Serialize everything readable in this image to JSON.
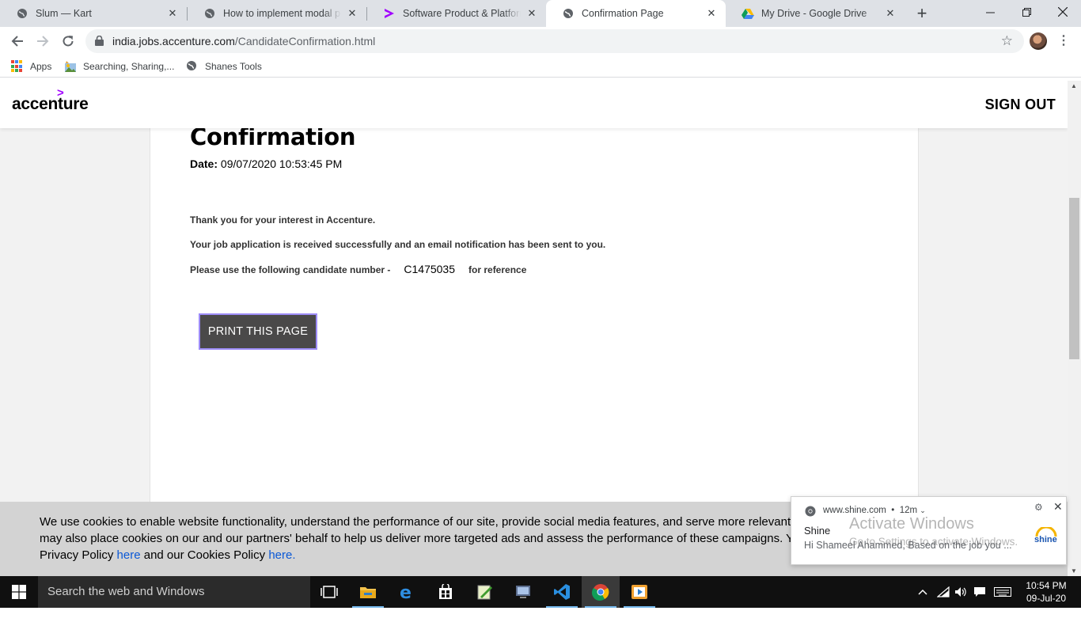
{
  "browser": {
    "tabs": [
      {
        "title": "Slum — Kart",
        "icon": "globe-icon",
        "active": false
      },
      {
        "title": "How to implement modal pop",
        "icon": "globe-icon",
        "active": false
      },
      {
        "title": "Software Product & Platforms",
        "icon": "accenture-icon",
        "active": false
      },
      {
        "title": "Confirmation Page",
        "icon": "globe-icon",
        "active": true
      },
      {
        "title": "My Drive - Google Drive",
        "icon": "drive-icon",
        "active": false
      }
    ],
    "new_tab": "+",
    "url_host": "india.jobs.accenture.com",
    "url_path": "/CandidateConfirmation.html",
    "bookmarks": [
      {
        "label": "Apps",
        "icon": "apps-grid-icon"
      },
      {
        "label": "Searching, Sharing,...",
        "icon": "bookmark-image-icon"
      },
      {
        "label": "Shanes Tools",
        "icon": "globe-icon"
      }
    ]
  },
  "site": {
    "logo": "accenture",
    "logo_accent": ">",
    "sign_out": "SIGN OUT",
    "accent_color": "#a100ff"
  },
  "confirmation": {
    "title": "Confirmation",
    "date_label": "Date:",
    "date_value": "09/07/2020 10:53:45 PM",
    "thank_you": "Thank you for your interest in Accenture.",
    "received": "Your job application is received successfully and an email notification has been sent to you.",
    "candidate_prefix": "Please use the following candidate number -",
    "candidate_number": "C1475035",
    "candidate_suffix": "for reference",
    "print_button": "PRINT THIS PAGE"
  },
  "cookie_banner": {
    "line1": "We use cookies to enable website functionality, understand the performance of our site, provide social media features, and serve more relevant cor",
    "line2": "may also place cookies on our and our partners' behalf to help us deliver more targeted ads and assess the performance of these campaigns. You",
    "line3_a": "Privacy Policy ",
    "link1": "here",
    "line3_b": " and our Cookies Policy ",
    "link2": "here."
  },
  "notification": {
    "source": "www.shine.com",
    "time": "12m",
    "title": "Shine",
    "body": "Hi Shameel Ahammed, Based on the job you ...",
    "brand": "shine"
  },
  "watermark": {
    "line1": "Activate Windows",
    "line2": "Go to Settings to activate Windows."
  },
  "taskbar": {
    "search_placeholder": "Search the web and Windows",
    "time": "10:54 PM",
    "date": "09-Jul-20"
  }
}
